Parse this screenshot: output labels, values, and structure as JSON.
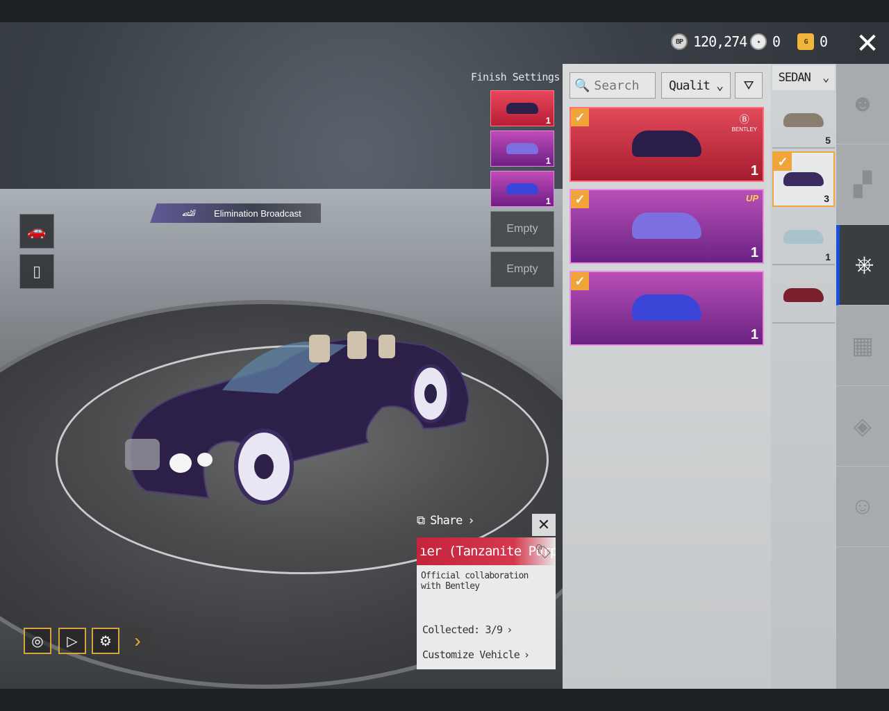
{
  "currency": {
    "bp": {
      "icon": "bp-coin-icon",
      "label": "BP",
      "value": "120,274"
    },
    "silver": {
      "icon": "silver-token-icon",
      "value": "0"
    },
    "gold": {
      "icon": "gold-coupon-icon",
      "label": "G",
      "value": "0"
    }
  },
  "finish_settings": {
    "title": "Finish Settings",
    "help": "?",
    "slots": [
      {
        "state": "filled",
        "color": "#c42b3f",
        "count": "1"
      },
      {
        "state": "filled",
        "color": "#9b3aa8",
        "count": "1"
      },
      {
        "state": "filled",
        "color": "#9b3aa8",
        "count": "1"
      },
      {
        "state": "empty",
        "label": "Empty"
      },
      {
        "state": "empty",
        "label": "Empty"
      }
    ]
  },
  "elimination_broadcast": {
    "label": "Elimination Broadcast"
  },
  "search": {
    "placeholder": "Search"
  },
  "quality": {
    "label": "Qualit"
  },
  "skins": [
    {
      "checked": true,
      "rarity": "red",
      "badge": "BENTLEY",
      "count": "1",
      "car_color": "#2b1d4a"
    },
    {
      "checked": true,
      "rarity": "purple",
      "badge": "UP",
      "count": "1",
      "car_color": "#7c6fe0"
    },
    {
      "checked": true,
      "rarity": "purple",
      "badge": "",
      "count": "1",
      "car_color": "#3b46d8"
    }
  ],
  "category": {
    "label": "SEDAN",
    "models": [
      {
        "count": "5",
        "car_color": "#8a7e6e",
        "selected": false
      },
      {
        "count": "3",
        "car_color": "#3a2c5e",
        "selected": true
      },
      {
        "count": "1",
        "car_color": "#a8c3cc",
        "selected": false
      },
      {
        "count": "",
        "car_color": "#7a1f2b",
        "selected": false
      }
    ]
  },
  "nav": [
    {
      "icon": "character-icon",
      "glyph": "☻"
    },
    {
      "icon": "gun-icon",
      "glyph": "▞"
    },
    {
      "icon": "steering-wheel-icon",
      "glyph": "⎈",
      "active": true
    },
    {
      "icon": "parachute-icon",
      "glyph": "▦"
    },
    {
      "icon": "backpack-icon",
      "glyph": "◈"
    },
    {
      "icon": "companion-icon",
      "glyph": "☺"
    }
  ],
  "popup": {
    "share": "Share",
    "title": "ıer (Tanzanite Purp",
    "description": "Official collaboration with Bentley",
    "collected": "Collected: 3/9",
    "customize": "Customize Vehicle"
  },
  "colors": {
    "accent": "#f0a43a",
    "nav_active": "#1c4fd9",
    "red_rarity": "#c42b3f",
    "purple_rarity": "#9b3aa8"
  }
}
